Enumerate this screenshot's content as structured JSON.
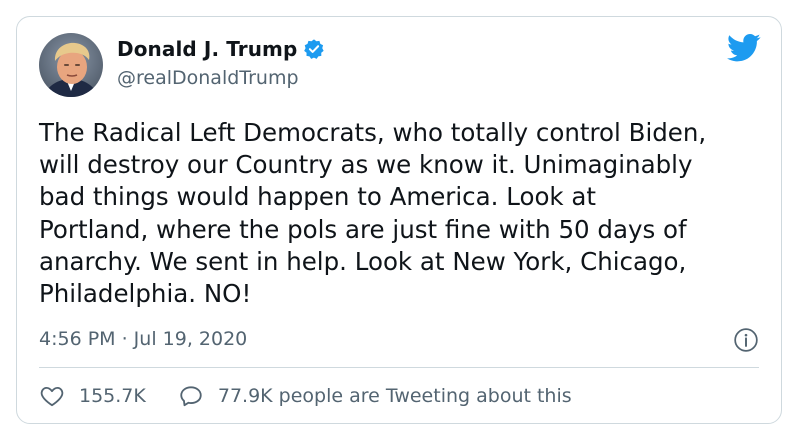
{
  "author": {
    "display_name": "Donald J. Trump",
    "handle": "@realDonaldTrump",
    "verified": true,
    "avatar_icon": "avatar"
  },
  "brand": {
    "icon": "twitter-bird-icon",
    "accent_color": "#1d9bf0"
  },
  "tweet": {
    "text_lines": [
      "The Radical Left Democrats, who totally control Biden,",
      "will destroy our Country as we know it. Unimaginably",
      "bad things would happen to America. Look at",
      "Portland, where the pols are just fine with 50 days of",
      "anarchy. We sent in help. Look at New York, Chicago,",
      "Philadelphia. NO!"
    ],
    "timestamp": "4:56 PM · Jul 19, 2020"
  },
  "engagement": {
    "likes": "155.7K",
    "tweeting_text": "77.9K people are Tweeting about this"
  },
  "colors": {
    "text": "#0f1419",
    "secondary": "#536471",
    "border": "#cfd9de"
  }
}
